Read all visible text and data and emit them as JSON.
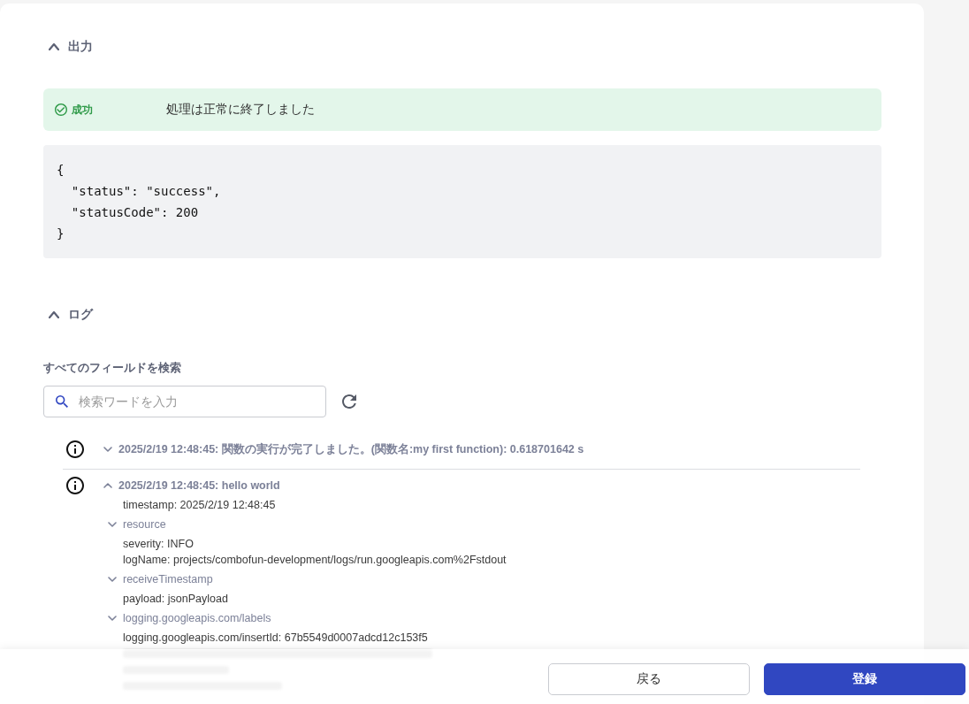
{
  "output": {
    "title": "出力",
    "expanded": true,
    "status": {
      "kind": "success",
      "label": "成功",
      "message": "処理は正常に終了しました"
    },
    "code": [
      "{",
      "  \"status\": \"success\",",
      "  \"statusCode\": 200",
      "}"
    ]
  },
  "logs": {
    "title": "ログ",
    "expanded": true,
    "search": {
      "label": "すべてのフィールドを検索",
      "placeholder": "検索ワードを入力"
    },
    "entries": [
      {
        "title": "2025/2/19 12:48:45: 関数の実行が完了しました。(関数名:my first function): 0.618701642 s",
        "expanded": false
      },
      {
        "title": "2025/2/19 12:48:45: hello world",
        "expanded": true,
        "children": [
          {
            "kind": "field",
            "text": "timestamp: 2025/2/19 12:48:45"
          },
          {
            "kind": "group",
            "text": "resource",
            "expanded": false
          },
          {
            "kind": "field",
            "text": "severity: INFO"
          },
          {
            "kind": "field",
            "text": "logName: projects/combofun-development/logs/run.googleapis.com%2Fstdout"
          },
          {
            "kind": "group",
            "text": "receiveTimestamp",
            "expanded": false
          },
          {
            "kind": "field",
            "text": "payload: jsonPayload"
          },
          {
            "kind": "group",
            "text": "logging.googleapis.com/labels",
            "expanded": false
          },
          {
            "kind": "field",
            "text": "logging.googleapis.com/insertId: 67b5549d0007adcd12c153f5"
          }
        ]
      }
    ]
  },
  "footer": {
    "buttons": [
      {
        "kind": "secondary",
        "label": "戻る"
      },
      {
        "kind": "primary",
        "label": "登録"
      }
    ]
  }
}
